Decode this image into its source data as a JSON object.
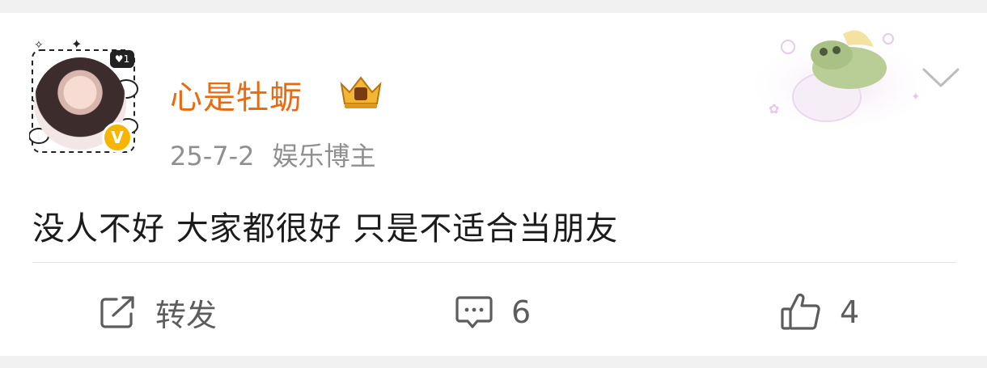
{
  "post": {
    "author": {
      "name": "心是牡蛎",
      "verified": true,
      "avatar_badge_count": "1"
    },
    "date": "25-7-2",
    "role": "娱乐博主",
    "text": "没人不好 大家都很好 只是不适合当朋友"
  },
  "actions": {
    "repost_label": "转发",
    "comment_count": "6",
    "like_count": "4"
  },
  "colors": {
    "username": "#e86b11",
    "meta": "#8f8f8f",
    "text": "#1b1b1b",
    "icon": "#5c5c5c",
    "verify": "#f7b500"
  },
  "icons": [
    "more-chevron-icon",
    "repost-icon",
    "comment-icon",
    "like-icon",
    "verified-badge-icon",
    "vip-crown-icon"
  ]
}
